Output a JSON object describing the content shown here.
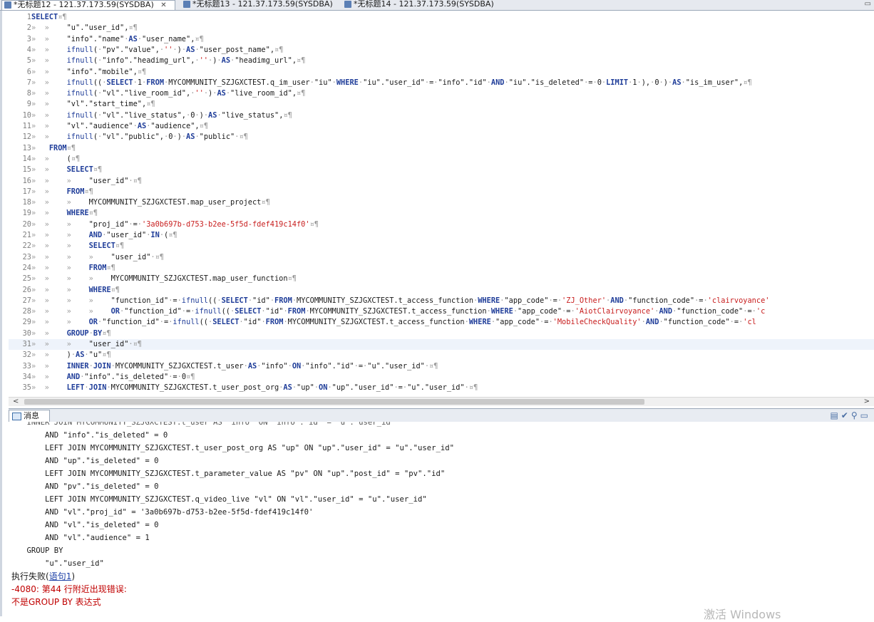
{
  "tabs": [
    {
      "label": "*无标题12 - 121.37.173.59(SYSDBA)",
      "active": true,
      "close": "✕"
    },
    {
      "label": "*无标题13 - 121.37.173.59(SYSDBA)",
      "active": false
    },
    {
      "label": "*无标题14 - 121.37.173.59(SYSDBA)",
      "active": false
    }
  ],
  "editor": {
    "current_line": 31,
    "lines": [
      {
        "n": "1",
        "tabs": 0,
        "code": "SELECT¤¶"
      },
      {
        "n": "2",
        "tabs": 2,
        "code": "\"u\".\"user_id\",¤¶"
      },
      {
        "n": "3",
        "tabs": 2,
        "code": "\"info\".\"name\"·AS·\"user_name\",¤¶"
      },
      {
        "n": "4",
        "tabs": 2,
        "code": "ifnull(·\"pv\".\"value\",·''·)·AS·\"user_post_name\",¤¶"
      },
      {
        "n": "5",
        "tabs": 2,
        "code": "ifnull(·\"info\".\"headimg_url\",·''·)·AS·\"headimg_url\",¤¶"
      },
      {
        "n": "6",
        "tabs": 2,
        "code": "\"info\".\"mobile\",¤¶"
      },
      {
        "n": "7",
        "tabs": 2,
        "code": "ifnull((·SELECT·1·FROM·MYCOMMUNITY_SZJGXCTEST.q_im_user·\"iu\"·WHERE·\"iu\".\"user_id\"·=·\"info\".\"id\"·AND·\"iu\".\"is_deleted\"·=·0·LIMIT·1·),·0·)·AS·\"is_im_user\",¤¶"
      },
      {
        "n": "8",
        "tabs": 2,
        "code": "ifnull(·\"vl\".\"live_room_id\",·''·)·AS·\"live_room_id\",¤¶"
      },
      {
        "n": "9",
        "tabs": 2,
        "code": "\"vl\".\"start_time\",¤¶"
      },
      {
        "n": "10",
        "tabs": 2,
        "code": "ifnull(·\"vl\".\"live_status\",·0·)·AS·\"live_status\",¤¶"
      },
      {
        "n": "11",
        "tabs": 2,
        "code": "\"vl\".\"audience\"·AS·\"audience\",¤¶"
      },
      {
        "n": "12",
        "tabs": 2,
        "code": "ifnull(·\"vl\".\"public\",·0·)·AS·\"public\"·¤¶"
      },
      {
        "n": "13",
        "tabs": 1,
        "code": "FROM¤¶"
      },
      {
        "n": "14",
        "tabs": 2,
        "code": "(¤¶"
      },
      {
        "n": "15",
        "tabs": 2,
        "code": "SELECT¤¶"
      },
      {
        "n": "16",
        "tabs": 3,
        "code": "\"user_id\"·¤¶"
      },
      {
        "n": "17",
        "tabs": 2,
        "code": "FROM¤¶"
      },
      {
        "n": "18",
        "tabs": 3,
        "code": "MYCOMMUNITY_SZJGXCTEST.map_user_project¤¶"
      },
      {
        "n": "19",
        "tabs": 2,
        "code": "WHERE¤¶"
      },
      {
        "n": "20",
        "tabs": 3,
        "code": "\"proj_id\"·=·'3a0b697b-d753-b2ee-5f5d-fdef419c14f0'¤¶"
      },
      {
        "n": "21",
        "tabs": 3,
        "code": "AND·\"user_id\"·IN·(¤¶"
      },
      {
        "n": "22",
        "tabs": 3,
        "code": "SELECT¤¶"
      },
      {
        "n": "23",
        "tabs": 4,
        "code": "\"user_id\"·¤¶"
      },
      {
        "n": "24",
        "tabs": 3,
        "code": "FROM¤¶"
      },
      {
        "n": "25",
        "tabs": 4,
        "code": "MYCOMMUNITY_SZJGXCTEST.map_user_function¤¶"
      },
      {
        "n": "26",
        "tabs": 3,
        "code": "WHERE¤¶"
      },
      {
        "n": "27",
        "tabs": 4,
        "code": "\"function_id\"·=·ifnull((·SELECT·\"id\"·FROM·MYCOMMUNITY_SZJGXCTEST.t_access_function·WHERE·\"app_code\"·=·'ZJ_Other'·AND·\"function_code\"·=·'clairvoyance'"
      },
      {
        "n": "28",
        "tabs": 4,
        "code": "OR·\"function_id\"·=·ifnull((·SELECT·\"id\"·FROM·MYCOMMUNITY_SZJGXCTEST.t_access_function·WHERE·\"app_code\"·=·'AiotClairvoyance'·AND·\"function_code\"·=·'c"
      },
      {
        "n": "29",
        "tabs": 3,
        "code": "OR·\"function_id\"·=·ifnull((·SELECT·\"id\"·FROM·MYCOMMUNITY_SZJGXCTEST.t_access_function·WHERE·\"app_code\"·=·'MobileCheckQuality'·AND·\"function_code\"·=·'cl"
      },
      {
        "n": "30",
        "tabs": 2,
        "code": "GROUP·BY¤¶"
      },
      {
        "n": "31",
        "tabs": 3,
        "code": "\"user_id\"·¤¶"
      },
      {
        "n": "32",
        "tabs": 2,
        "code": ")·AS·\"u\"¤¶"
      },
      {
        "n": "33",
        "tabs": 2,
        "code": "INNER·JOIN·MYCOMMUNITY_SZJGXCTEST.t_user·AS·\"info\"·ON·\"info\".\"id\"·=·\"u\".\"user_id\"·¤¶"
      },
      {
        "n": "34",
        "tabs": 2,
        "code": "AND·\"info\".\"is_deleted\"·=·0¤¶"
      },
      {
        "n": "35",
        "tabs": 2,
        "code": "LEFT·JOIN·MYCOMMUNITY_SZJGXCTEST.t_user_post_org·AS·\"up\"·ON·\"up\".\"user_id\"·=·\"u\".\"user_id\"·¤¶"
      }
    ]
  },
  "scrollbar": {
    "left": "<",
    "right": ">"
  },
  "messages": {
    "tab_label": "消息",
    "toolbar_icons": [
      "view-menu-icon",
      "clear-icon",
      "pin-icon",
      "minimize-icon"
    ],
    "cut_line": "    INNER JOIN MYCOMMUNITY_SZJGXCTEST.t_user AS \"info\" ON \"info\".\"id\" = \"u\".\"user_id\"",
    "lines": [
      "        AND \"info\".\"is_deleted\" = 0",
      "        LEFT JOIN MYCOMMUNITY_SZJGXCTEST.t_user_post_org AS \"up\" ON \"up\".\"user_id\" = \"u\".\"user_id\"",
      "        AND \"up\".\"is_deleted\" = 0",
      "        LEFT JOIN MYCOMMUNITY_SZJGXCTEST.t_parameter_value AS \"pv\" ON \"up\".\"post_id\" = \"pv\".\"id\"",
      "        AND \"pv\".\"is_deleted\" = 0",
      "        LEFT JOIN MYCOMMUNITY_SZJGXCTEST.q_video_live \"vl\" ON \"vl\".\"user_id\" = \"u\".\"user_id\"",
      "        AND \"vl\".\"proj_id\" = '3a0b697b-d753-b2ee-5f5d-fdef419c14f0'",
      "        AND \"vl\".\"is_deleted\" = 0",
      "        AND \"vl\".\"audience\" = 1",
      "    GROUP BY",
      "        \"u\".\"user_id\""
    ],
    "status_prefix": "执行失败(",
    "status_link": "语句1",
    "status_suffix": ")",
    "error_line": "-4080: 第44 行附近出现错误:",
    "error_detail": "不是GROUP BY 表达式"
  },
  "watermark": "激活 Windows",
  "colors": {
    "keyword": "#1f3d99",
    "string": "#c81e1e",
    "number": "#1a1a1a",
    "error": "#c00000"
  }
}
